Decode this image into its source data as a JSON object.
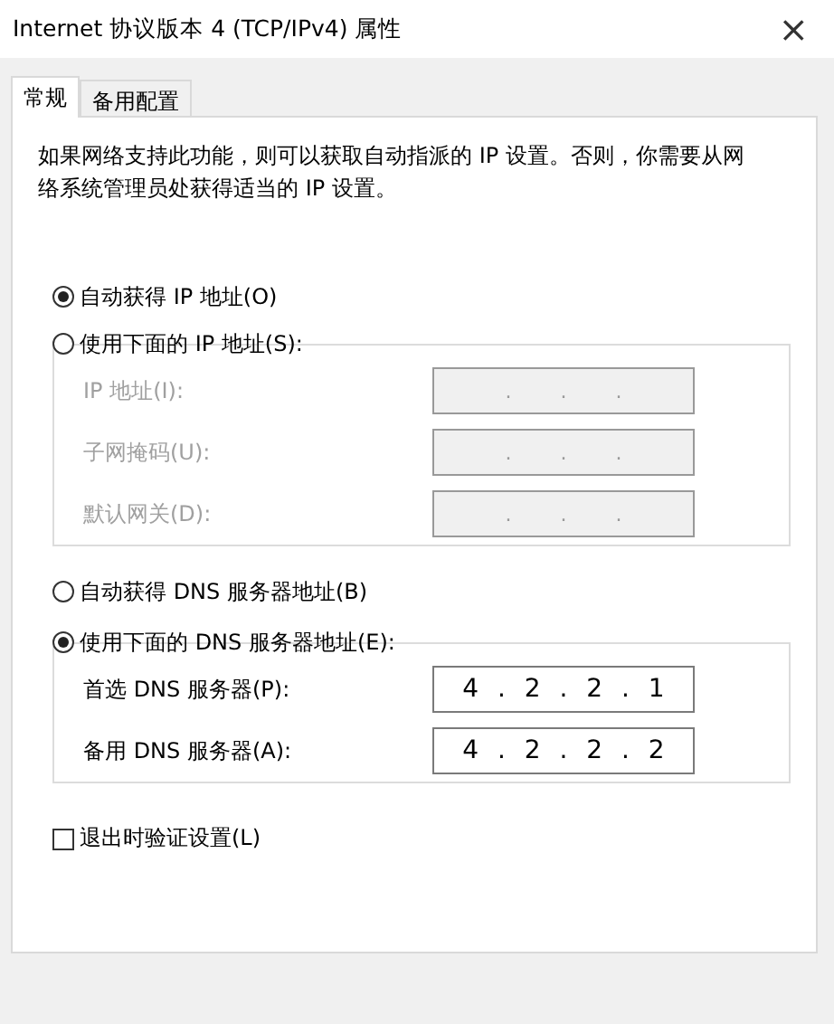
{
  "window": {
    "title": "Internet 协议版本 4 (TCP/IPv4) 属性",
    "close": "×"
  },
  "tabs": [
    {
      "label": "常规",
      "selected": true
    },
    {
      "label": "备用配置",
      "selected": false
    }
  ],
  "description": "如果网络支持此功能，则可以获取自动指派的 IP 设置。否则，你需要从网络系统管理员处获得适当的 IP 设置。",
  "ip_section": {
    "auto": {
      "label": "自动获得 IP 地址(O)",
      "selected": true
    },
    "manual": {
      "label": "使用下面的 IP 地址(S):",
      "selected": false
    },
    "disabled": true,
    "fields": [
      {
        "label": "IP 地址(I):",
        "value": ".  .  ."
      },
      {
        "label": "子网掩码(U):",
        "value": ".  .  ."
      },
      {
        "label": "默认网关(D):",
        "value": ".  .  ."
      }
    ]
  },
  "dns_section": {
    "auto": {
      "label": "自动获得 DNS 服务器地址(B)",
      "selected": false
    },
    "manual": {
      "label": "使用下面的 DNS 服务器地址(E):",
      "selected": true
    },
    "disabled": false,
    "fields": [
      {
        "label": "首选 DNS 服务器(P):",
        "value": "4 . 2 . 2 . 1"
      },
      {
        "label": "备用 DNS 服务器(A):",
        "value": "4 . 2 . 2 . 2"
      }
    ]
  },
  "validate": {
    "label": "退出时验证设置(L)",
    "checked": false
  }
}
